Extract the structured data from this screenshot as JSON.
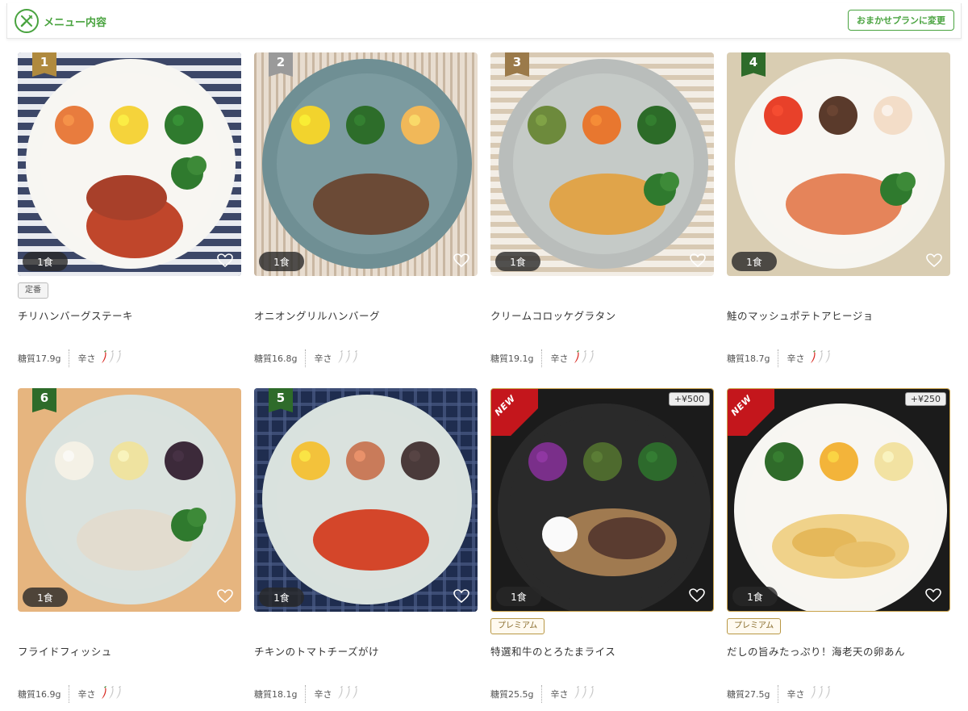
{
  "header": {
    "title": "メニュー内容",
    "plan_button": "おまかせプランに変更",
    "brand_color": "#49a33f"
  },
  "spice_label": "辛さ",
  "menu": [
    {
      "rank": "1",
      "rank_color": "#b08a3e",
      "new": false,
      "price": "",
      "qty": "1食",
      "tag": "定番",
      "tag_type": "standard",
      "name": "チリハンバーグステーキ",
      "sugar": "糖質17.9g",
      "spice": 1,
      "bg": "stripes-navy"
    },
    {
      "rank": "2",
      "rank_color": "#9a9a9a",
      "new": false,
      "price": "",
      "qty": "1食",
      "tag": "",
      "tag_type": "",
      "name": "オニオングリルハンバーグ",
      "sugar": "糖質16.8g",
      "spice": 0,
      "bg": "stripes-tan"
    },
    {
      "rank": "3",
      "rank_color": "#9b7a4a",
      "new": false,
      "price": "",
      "qty": "1食",
      "tag": "",
      "tag_type": "",
      "name": "クリームコロッケグラタン",
      "sugar": "糖質19.1g",
      "spice": 1,
      "bg": "stripes-beige"
    },
    {
      "rank": "4",
      "rank_color": "#2e6b2a",
      "new": false,
      "price": "",
      "qty": "1食",
      "tag": "",
      "tag_type": "",
      "name": "鮭のマッシュポテトアヒージョ",
      "sugar": "糖質18.7g",
      "spice": 1,
      "bg": "linen"
    },
    {
      "rank": "6",
      "rank_color": "#2e6b2a",
      "new": false,
      "price": "",
      "qty": "1食",
      "tag": "",
      "tag_type": "",
      "name": "フライドフィッシュ",
      "sugar": "糖質16.9g",
      "spice": 1,
      "bg": "wood"
    },
    {
      "rank": "5",
      "rank_color": "#2e6b2a",
      "new": false,
      "price": "",
      "qty": "1食",
      "tag": "",
      "tag_type": "",
      "name": "チキンのトマトチーズがけ",
      "sugar": "糖質18.1g",
      "spice": 0,
      "bg": "check-navy"
    },
    {
      "rank": "",
      "rank_color": "",
      "new": true,
      "price": "+¥500",
      "qty": "1食",
      "tag": "プレミアム",
      "tag_type": "premium",
      "name": "特選和牛のとろたまライス",
      "sugar": "糖質25.5g",
      "spice": 0,
      "bg": "black"
    },
    {
      "rank": "",
      "rank_color": "",
      "new": true,
      "price": "+¥250",
      "qty": "1食",
      "tag": "プレミアム",
      "tag_type": "premium",
      "name": "だしの旨みたっぷり！海老天の卵あん",
      "sugar": "糖質27.5g",
      "spice": 0,
      "bg": "black"
    }
  ]
}
